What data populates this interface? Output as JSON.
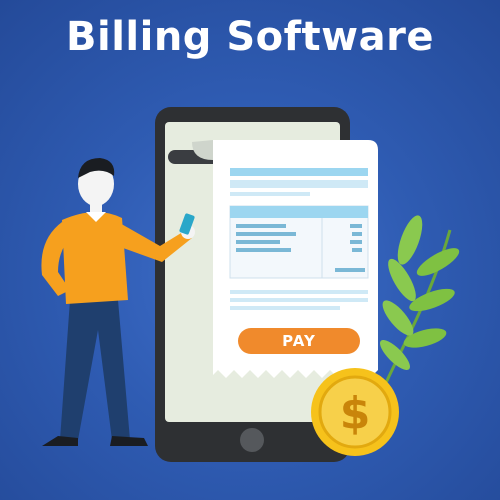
{
  "title": "Billing Software",
  "pay_button": {
    "label": "PAY"
  },
  "icons": {
    "coin": "dollar-coin-icon",
    "home": "phone-home-button-icon"
  },
  "colors": {
    "background": "#2f5cb3",
    "pay": "#f08a2c",
    "coin": "#f6c21b",
    "leaf": "#7fc142",
    "shirt": "#f6a01e",
    "pants": "#1f3f6e",
    "receipt_accent": "#9cd6f0"
  }
}
